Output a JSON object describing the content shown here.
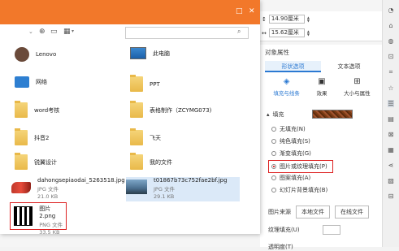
{
  "dimensions": {
    "height": "14.90厘米",
    "width": "15.62厘米"
  },
  "props_panel": {
    "title": "对象属性",
    "tabs": [
      "形状选项",
      "文本选项"
    ],
    "sub_tabs": [
      "填充与线条",
      "效果",
      "大小与属性"
    ],
    "fill_section": "填充",
    "fill_options": [
      "无填充(N)",
      "纯色填充(S)",
      "渐变填充(G)",
      "图片或纹理填充(P)",
      "图案填充(A)",
      "幻灯片背景填充(B)"
    ],
    "image_source_label": "图片来源",
    "local_file_button": "本地文件",
    "online_file_button": "在线文件",
    "texture_fill_label": "纹理填充(U)",
    "transparency_label": "透明度(T)"
  },
  "files": [
    {
      "name": "Lenovo",
      "type": "user"
    },
    {
      "name": "此电脑",
      "type": "pc"
    },
    {
      "name": "网络",
      "type": "network"
    },
    {
      "name": "PPT",
      "type": "folder"
    },
    {
      "name": "word考核",
      "type": "folder"
    },
    {
      "name": "表格制作（ZCYMG073)",
      "type": "folder"
    },
    {
      "name": "抖音2",
      "type": "folder"
    },
    {
      "name": "飞天",
      "type": "folder"
    },
    {
      "name": "锐翼设计",
      "type": "folder"
    },
    {
      "name": "我的文件",
      "type": "folder"
    },
    {
      "name": "dahongsepiaodai_5263518.jpg",
      "type": "image",
      "kind": "JPG 文件",
      "size": "21.0 KB"
    },
    {
      "name": "t01867b73c752fae2bf.jpg",
      "type": "image",
      "kind": "JPG 文件",
      "size": "29.1 KB"
    },
    {
      "name": "图片2.png",
      "type": "qr",
      "kind": "PNG 文件",
      "size": "33.5 KB"
    }
  ],
  "colors": {
    "title_bar": "#f2782a",
    "accent": "#2b79d2",
    "highlight_red": "#d22222"
  }
}
